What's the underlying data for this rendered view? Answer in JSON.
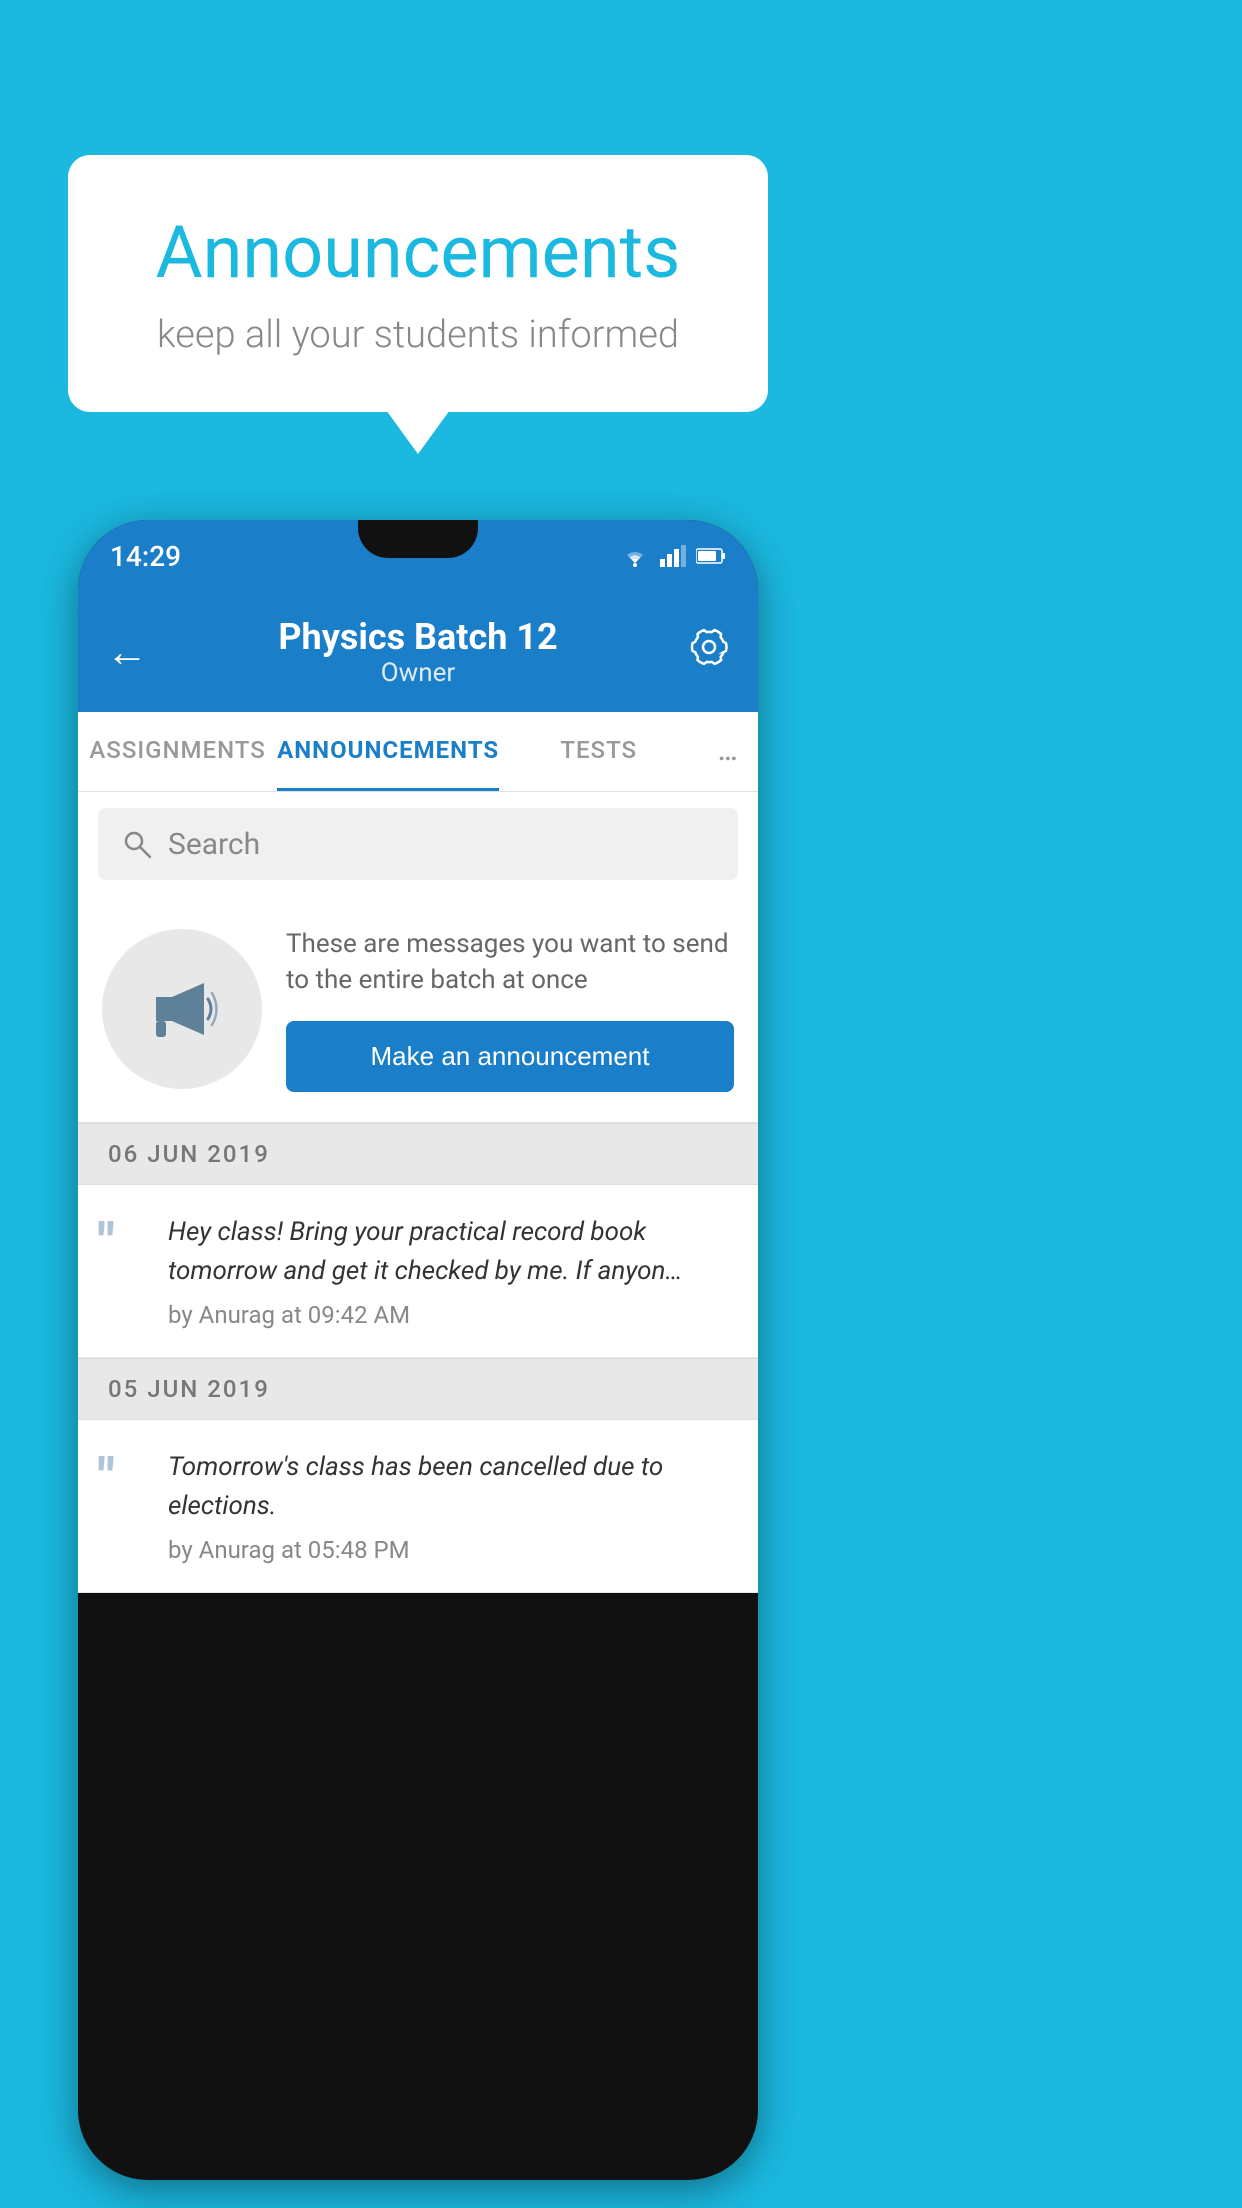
{
  "background_color": "#1bb8e0",
  "speech_bubble": {
    "title": "Announcements",
    "subtitle": "keep all your students informed"
  },
  "status_bar": {
    "time": "14:29",
    "wifi_icon": "wifi",
    "signal_icon": "signal",
    "battery_icon": "battery"
  },
  "app_bar": {
    "title": "Physics Batch 12",
    "subtitle": "Owner",
    "back_label": "←",
    "settings_label": "⚙"
  },
  "tabs": [
    {
      "label": "ASSIGNMENTS",
      "active": false
    },
    {
      "label": "ANNOUNCEMENTS",
      "active": true
    },
    {
      "label": "TESTS",
      "active": false
    },
    {
      "label": "…",
      "active": false
    }
  ],
  "search": {
    "placeholder": "Search"
  },
  "announcement_prompt": {
    "description": "These are messages you want to send to the entire batch at once",
    "button_label": "Make an announcement"
  },
  "announcements": [
    {
      "date": "06  JUN  2019",
      "message": "Hey class! Bring your practical record book tomorrow and get it checked by me. If anyon…",
      "author": "by Anurag at 09:42 AM"
    },
    {
      "date": "05  JUN  2019",
      "message": "Tomorrow's class has been cancelled due to elections.",
      "author": "by Anurag at 05:48 PM"
    }
  ]
}
